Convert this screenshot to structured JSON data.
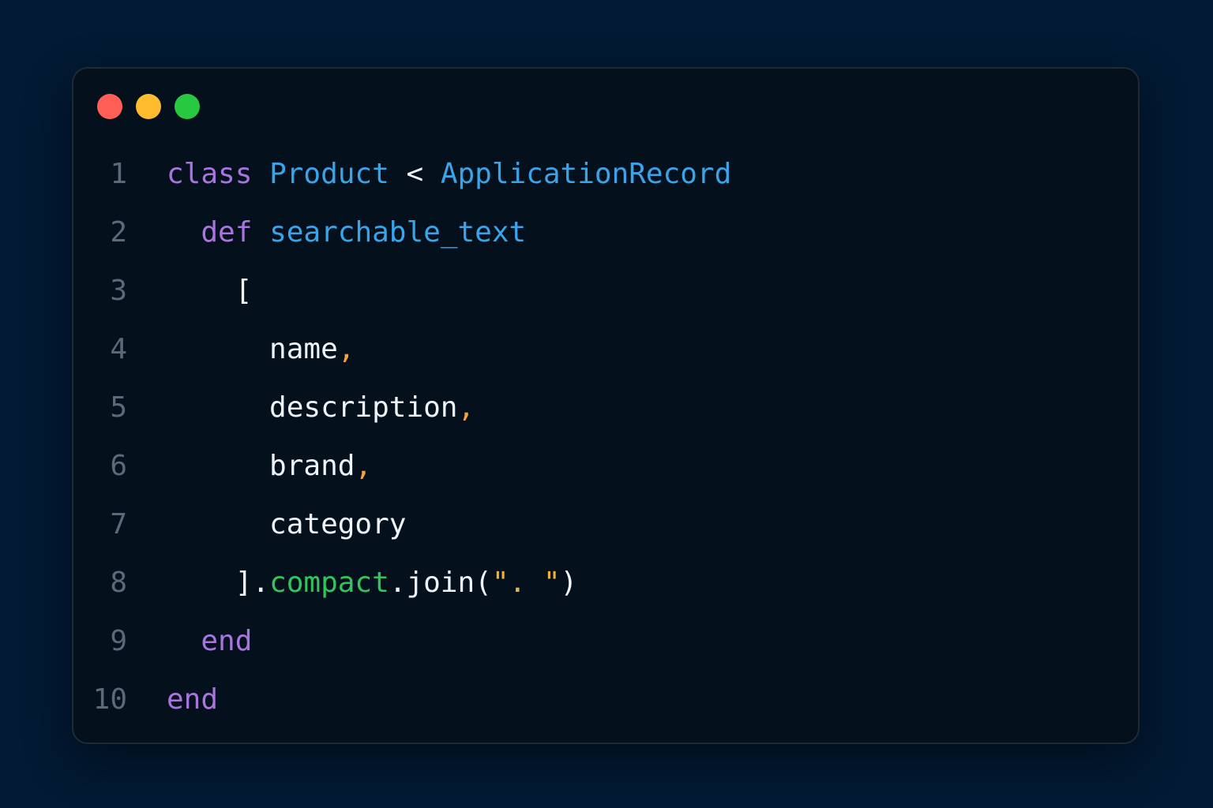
{
  "window": {
    "controls": [
      {
        "name": "close",
        "color": "#ff5f57"
      },
      {
        "name": "minimize",
        "color": "#febc2e"
      },
      {
        "name": "zoom",
        "color": "#28c840"
      }
    ]
  },
  "code": {
    "lines": [
      {
        "number": "1",
        "indent": "",
        "tokens": [
          {
            "text": "class",
            "type": "keyword"
          },
          {
            "text": " ",
            "type": "plain"
          },
          {
            "text": "Product",
            "type": "type"
          },
          {
            "text": " < ",
            "type": "plain"
          },
          {
            "text": "ApplicationRecord",
            "type": "type"
          }
        ]
      },
      {
        "number": "2",
        "indent": "  ",
        "tokens": [
          {
            "text": "def",
            "type": "keyword"
          },
          {
            "text": " ",
            "type": "plain"
          },
          {
            "text": "searchable_text",
            "type": "function"
          }
        ]
      },
      {
        "number": "3",
        "indent": "    ",
        "tokens": [
          {
            "text": "[",
            "type": "punctuation"
          }
        ]
      },
      {
        "number": "4",
        "indent": "      ",
        "tokens": [
          {
            "text": "name",
            "type": "plain"
          },
          {
            "text": ",",
            "type": "comma"
          }
        ]
      },
      {
        "number": "5",
        "indent": "      ",
        "tokens": [
          {
            "text": "description",
            "type": "plain"
          },
          {
            "text": ",",
            "type": "comma"
          }
        ]
      },
      {
        "number": "6",
        "indent": "      ",
        "tokens": [
          {
            "text": "brand",
            "type": "plain"
          },
          {
            "text": ",",
            "type": "comma"
          }
        ]
      },
      {
        "number": "7",
        "indent": "      ",
        "tokens": [
          {
            "text": "category",
            "type": "plain"
          }
        ]
      },
      {
        "number": "8",
        "indent": "    ",
        "tokens": [
          {
            "text": "].",
            "type": "punctuation"
          },
          {
            "text": "compact",
            "type": "method"
          },
          {
            "text": ".join(",
            "type": "plain"
          },
          {
            "text": "\". \"",
            "type": "string"
          },
          {
            "text": ")",
            "type": "punctuation"
          }
        ]
      },
      {
        "number": "9",
        "indent": "  ",
        "tokens": [
          {
            "text": "end",
            "type": "keyword"
          }
        ]
      },
      {
        "number": "10",
        "indent": "",
        "tokens": [
          {
            "text": "end",
            "type": "keyword"
          }
        ]
      }
    ]
  },
  "theme": {
    "background": "#021a33",
    "window_background": "#04111d",
    "line_number": "#5e6977",
    "keyword": "#a875e0",
    "type": "#38a4ea",
    "function": "#38a4ea",
    "plain": "#eef3f8",
    "comma": "#f2a33a",
    "method": "#34c45c",
    "string": "#f3b13f"
  }
}
